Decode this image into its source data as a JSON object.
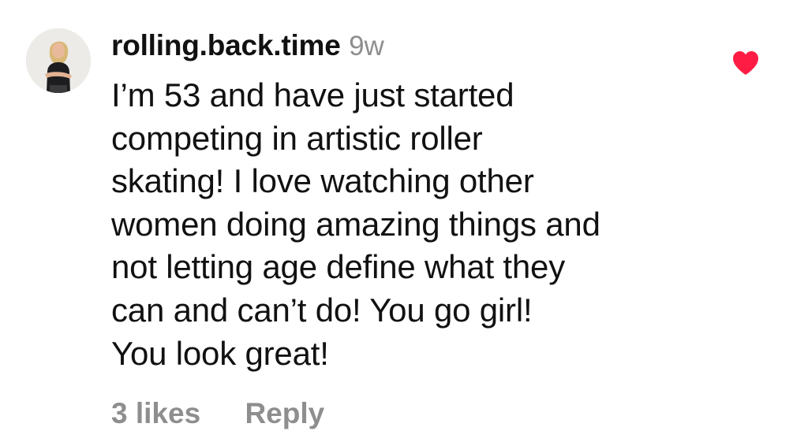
{
  "comment": {
    "username": "rolling.back.time",
    "timestamp": "9w",
    "text_lines": [
      "I’m 53 and have just started",
      "competing in artistic roller",
      "skating!  I love watching other",
      "women doing amazing things and",
      "not letting age define what they",
      "can and can’t do!  You go girl!",
      "You look great!"
    ],
    "likes_label": "3 likes",
    "reply_label": "Reply",
    "liked": true,
    "avatar_icon": "user-avatar",
    "heart_icon": "heart-filled-icon",
    "colors": {
      "text": "#111111",
      "muted": "#8e8e8e",
      "heart": "#ff1c44"
    }
  }
}
